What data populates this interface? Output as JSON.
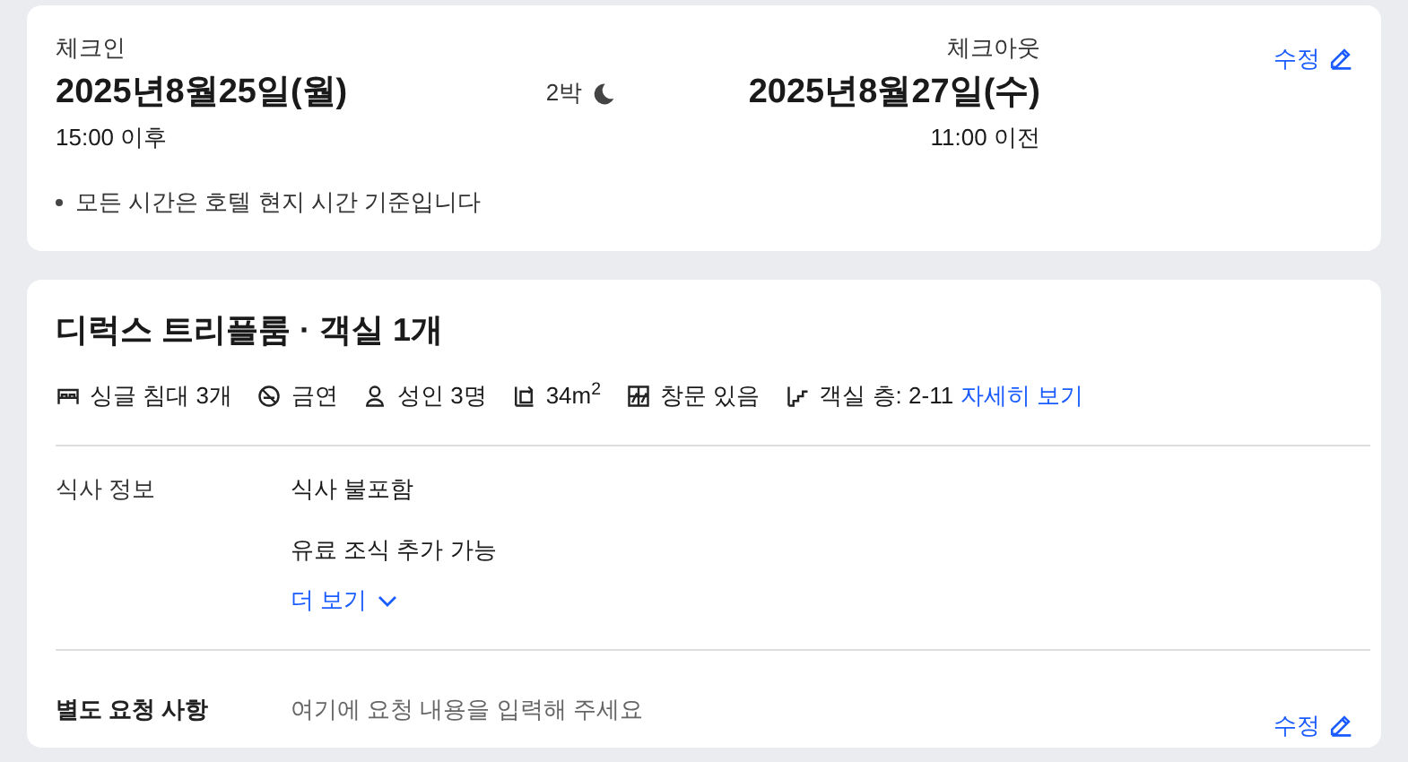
{
  "stay": {
    "checkin": {
      "label": "체크인",
      "date": "2025년8월25일(월)",
      "time": "15:00 이후"
    },
    "nights": "2박",
    "checkout": {
      "label": "체크아웃",
      "date": "2025년8월27일(수)",
      "time": "11:00 이전"
    },
    "edit_link": "수정",
    "note": "모든 시간은 호텔 현지 시간 기준입니다"
  },
  "room": {
    "title": "디럭스 트리플룸 · 객실 1개",
    "amenities": [
      {
        "kind": "bed",
        "text": "싱글 침대 3개"
      },
      {
        "kind": "no-smoking",
        "text": "금연"
      },
      {
        "kind": "person",
        "text": "성인 3명"
      },
      {
        "kind": "area",
        "text": "34m$^{2}$"
      },
      {
        "kind": "window",
        "text": "창문 있음"
      },
      {
        "kind": "floor",
        "text": "객실 층: 2-11"
      }
    ],
    "details_link": "자세히 보기",
    "meal": {
      "label": "식사 정보",
      "lines": [
        "식사 불포함",
        "유료 조식 추가 가능"
      ],
      "more_link": "더 보기"
    },
    "request": {
      "label": "별도 요청 사항",
      "placeholder": "여기에 요청 내용을 입력해 주세요",
      "edit_link": "수정"
    }
  }
}
